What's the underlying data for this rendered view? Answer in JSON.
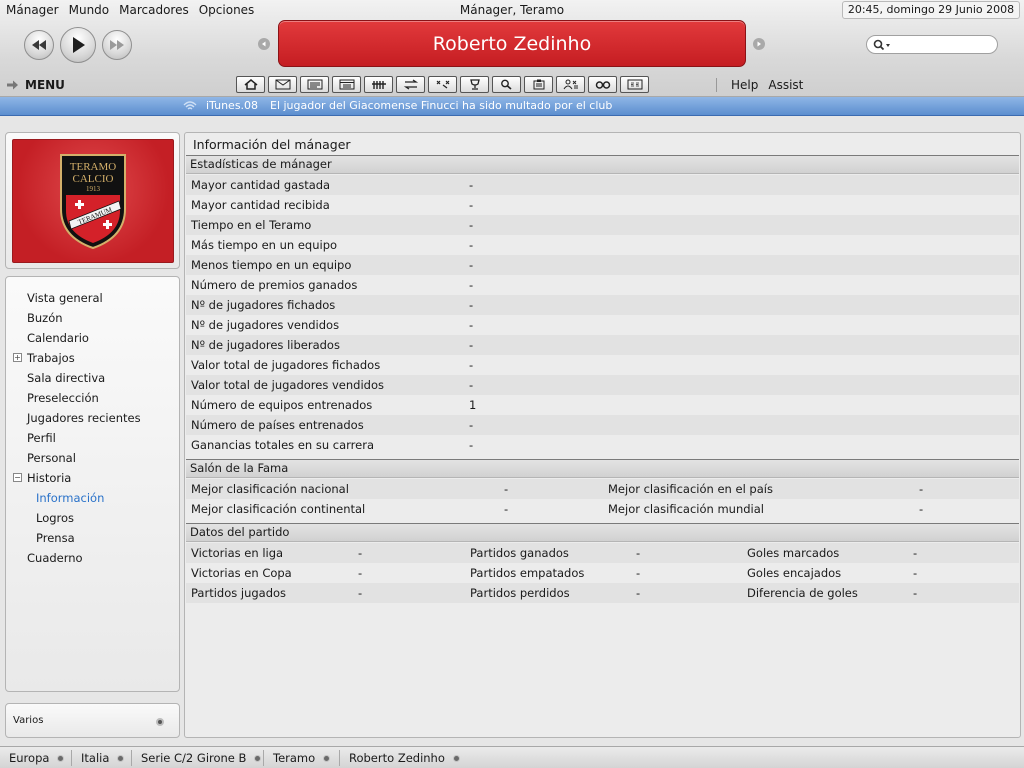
{
  "menubar": {
    "items": [
      "Mánager",
      "Mundo",
      "Marcadores",
      "Opciones"
    ]
  },
  "window_title": "Mánager, Teramo",
  "clock": "20:45, domingo 29 Junio 2008",
  "header": {
    "title": "Roberto Zedinho"
  },
  "menu": {
    "label": "MENU",
    "toolbar_icons": [
      "home-icon",
      "mail-icon",
      "news-icon",
      "calendar-icon",
      "squad-icon",
      "transfers-icon",
      "tactics-icon",
      "trophy-icon",
      "search-icon",
      "clipboard-icon",
      "staff-icon",
      "glasses-icon",
      "finances-icon"
    ],
    "links": [
      "Help",
      "Assist"
    ]
  },
  "ticker": {
    "source": "iTunes.08",
    "message": "El jugador del Giacomense Finucci ha sido multado por el club"
  },
  "club_logo": {
    "line1": "TERAMO",
    "line2": "CALCIO",
    "year": "1913",
    "banner": "TERAMUM"
  },
  "sidebar": {
    "items": [
      {
        "label": "Vista general"
      },
      {
        "label": "Buzón"
      },
      {
        "label": "Calendario"
      },
      {
        "label": "Trabajos"
      },
      {
        "label": "Sala directiva"
      },
      {
        "label": "Preselección"
      },
      {
        "label": "Jugadores recientes"
      },
      {
        "label": "Perfil"
      },
      {
        "label": "Personal"
      },
      {
        "label": "Historia"
      },
      {
        "label": "Información"
      },
      {
        "label": "Logros"
      },
      {
        "label": "Prensa"
      },
      {
        "label": "Cuaderno"
      }
    ],
    "varios": "Varios"
  },
  "main": {
    "title": "Información del mánager",
    "stats_header": "Estadísticas de mánager",
    "stats": [
      {
        "label": "Mayor cantidad gastada",
        "value": "-"
      },
      {
        "label": "Mayor cantidad recibida",
        "value": "-"
      },
      {
        "label": "Tiempo en el Teramo",
        "value": "-"
      },
      {
        "label": "Más tiempo en un equipo",
        "value": "-"
      },
      {
        "label": "Menos tiempo en un equipo",
        "value": "-"
      },
      {
        "label": "Número de premios ganados",
        "value": "-"
      },
      {
        "label": "Nº de jugadores fichados",
        "value": "-"
      },
      {
        "label": "Nº de jugadores vendidos",
        "value": "-"
      },
      {
        "label": "Nº de jugadores liberados",
        "value": "-"
      },
      {
        "label": "Valor total de jugadores fichados",
        "value": "-"
      },
      {
        "label": "Valor total de jugadores vendidos",
        "value": "-"
      },
      {
        "label": "Número de equipos entrenados",
        "value": "1"
      },
      {
        "label": "Número de países entrenados",
        "value": "-"
      },
      {
        "label": "Ganancias totales en su carrera",
        "value": "-"
      }
    ],
    "fame_header": "Salón de la Fama",
    "fame": [
      {
        "label1": "Mejor clasificación nacional",
        "value1": "-",
        "label2": "Mejor clasificación en el país",
        "value2": "-"
      },
      {
        "label1": "Mejor clasificación continental",
        "value1": "-",
        "label2": "Mejor clasificación mundial",
        "value2": "-"
      }
    ],
    "match_header": "Datos del partido",
    "match": [
      {
        "l1": "Victorias en liga",
        "v1": "-",
        "l2": "Partidos ganados",
        "v2": "-",
        "l3": "Goles marcados",
        "v3": "-"
      },
      {
        "l1": "Victorias en Copa",
        "v1": "-",
        "l2": "Partidos empatados",
        "v2": "-",
        "l3": "Goles encajados",
        "v3": "-"
      },
      {
        "l1": "Partidos jugados",
        "v1": "-",
        "l2": "Partidos perdidos",
        "v2": "-",
        "l3": "Diferencia de goles",
        "v3": "-"
      }
    ]
  },
  "breadcrumbs": [
    "Europa",
    "Italia",
    "Serie C/2 Girone B",
    "Teramo",
    "Roberto Zedinho"
  ]
}
